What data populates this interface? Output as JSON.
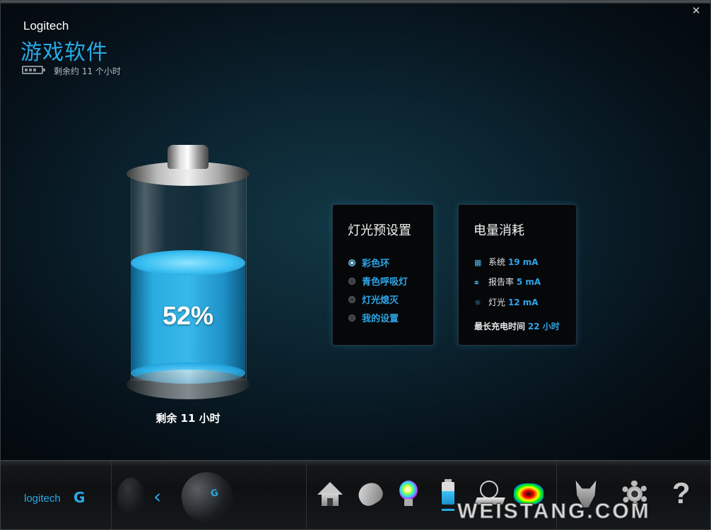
{
  "header": {
    "brand": "Logitech",
    "app_title": "游戏软件",
    "battery_remaining": "剩余约 11 个小时",
    "close_glyph": "✕"
  },
  "battery": {
    "percent_label": "52%",
    "percent": 52,
    "remaining": "剩余 11 小时"
  },
  "lighting_panel": {
    "title": "灯光预设置",
    "options": [
      {
        "label": "彩色环",
        "selected": true
      },
      {
        "label": "青色呼吸灯",
        "selected": false
      },
      {
        "label": "灯光熄灭",
        "selected": false
      },
      {
        "label": "我的设置",
        "selected": false
      }
    ]
  },
  "power_panel": {
    "title": "电量消耗",
    "rows": [
      {
        "label": "系统",
        "value": "19 mA",
        "icon": "chip-icon"
      },
      {
        "label": "报告率",
        "value": "5 mA",
        "icon": "report-rate-icon"
      },
      {
        "label": "灯光",
        "value": "12 mA",
        "icon": "light-icon"
      }
    ],
    "max_label": "最长充电时间",
    "max_value": "22 小时"
  },
  "bottombar": {
    "logo_text": "logitech",
    "logo_mark": "G",
    "back_glyph": "‹",
    "mouse_mark": "G",
    "help_glyph": "?",
    "watermark": "WEISTANG.COM"
  },
  "colors": {
    "accent": "#2aa9e6",
    "panel_bg": "#050709",
    "window_bg": "#061119"
  }
}
